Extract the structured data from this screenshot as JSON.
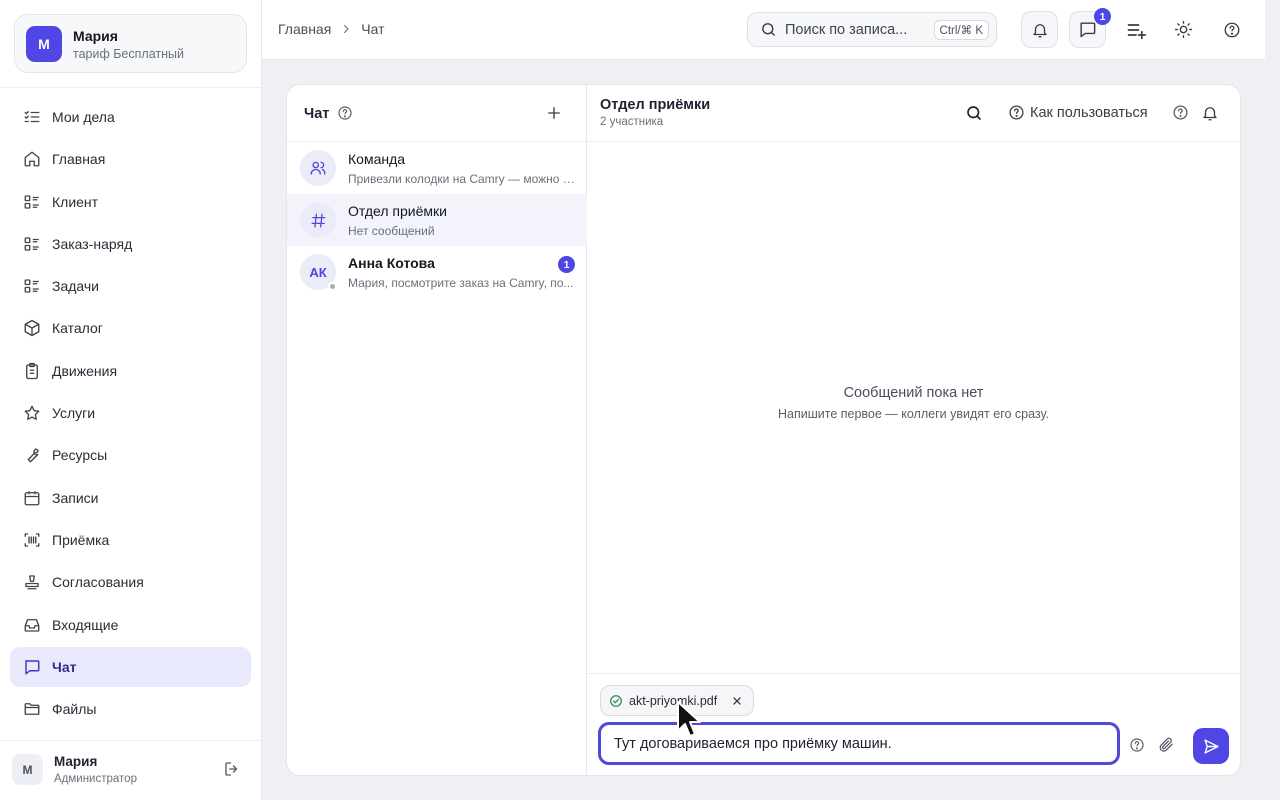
{
  "profile": {
    "initial": "М",
    "name": "Мария",
    "plan": "тариф Бесплатный"
  },
  "sidebar": {
    "items": [
      {
        "label": "Мои дела",
        "icon": "checklist-icon"
      },
      {
        "label": "Главная",
        "icon": "home-icon"
      },
      {
        "label": "Клиент",
        "icon": "list-icon"
      },
      {
        "label": "Заказ-наряд",
        "icon": "list-icon"
      },
      {
        "label": "Задачи",
        "icon": "list-icon"
      },
      {
        "label": "Каталог",
        "icon": "box-icon"
      },
      {
        "label": "Движения",
        "icon": "clipboard-icon"
      },
      {
        "label": "Услуги",
        "icon": "star-icon"
      },
      {
        "label": "Ресурсы",
        "icon": "wrench-icon"
      },
      {
        "label": "Записи",
        "icon": "calendar-icon"
      },
      {
        "label": "Приёмка",
        "icon": "scan-icon"
      },
      {
        "label": "Согласования",
        "icon": "stamp-icon"
      },
      {
        "label": "Входящие",
        "icon": "inbox-icon"
      },
      {
        "label": "Чат",
        "icon": "chat-icon",
        "active": true
      },
      {
        "label": "Файлы",
        "icon": "folder-icon"
      }
    ]
  },
  "user": {
    "initial": "М",
    "name": "Мария",
    "role": "Администратор"
  },
  "breadcrumb": {
    "home": "Главная",
    "current": "Чат"
  },
  "search": {
    "placeholder": "Поиск по записям...",
    "display": "Поиск по записа...",
    "shortcut": "Ctrl/⌘ K"
  },
  "topbar": {
    "chat_badge": "1"
  },
  "chat_list": {
    "title": "Чат",
    "conversations": [
      {
        "name": "Команда",
        "preview": "Привезли колодки на Camry — можно с...",
        "avatar_icon": "users-icon"
      },
      {
        "name": "Отдел приёмки",
        "preview": "Нет сообщений",
        "avatar_icon": "hash-icon",
        "active": true
      },
      {
        "name": "Анна Котова",
        "preview": "Мария, посмотрите заказ на Camry, по...",
        "avatar_text": "АК",
        "badge": "1"
      }
    ]
  },
  "chat": {
    "title": "Отдел приёмки",
    "subtitle": "2 участника",
    "how_to": "Как пользоваться",
    "empty_title": "Сообщений пока нет",
    "empty_sub": "Напишите первое — коллеги увидят его сразу.",
    "attachment": "akt-priyomki.pdf",
    "input_value": "Тут договариваемся про приёмку машин."
  },
  "colors": {
    "accent": "#4f46e5",
    "active_bg": "#e8e9fb"
  }
}
